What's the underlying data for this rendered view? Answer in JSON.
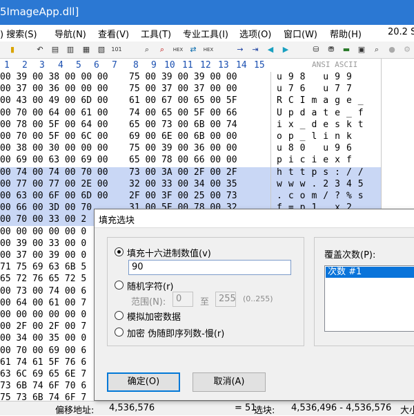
{
  "window": {
    "title": "5ImageApp.dll]"
  },
  "menu": [
    ") 搜索(S)",
    "导航(N)",
    "查看(V)",
    "工具(T)",
    "专业工具(I)",
    "选项(O)",
    "窗口(W)",
    "帮助(H)",
    "20.2 S"
  ],
  "toolbar_icons": [
    "new-icon",
    "open-icon",
    "undo-icon",
    "copy-icon",
    "paste-icon",
    "clipboard-icon",
    "copy-hex-icon",
    "binary-icon",
    "find-icon",
    "find-next-icon",
    "find-hex-icon",
    "replace-icon",
    "replace-hex-icon",
    "goto-icon",
    "goto-offset-icon",
    "back-icon",
    "forward-icon",
    "disk-icon",
    "save-disk-icon",
    "ram-icon",
    "table-icon",
    "zoom-icon",
    "gray-icon",
    "settings-icon"
  ],
  "columns": {
    "hex": [
      "1",
      "2",
      "3",
      "4",
      "5",
      "6",
      "7",
      "8",
      "9",
      "10",
      "11",
      "12",
      "13",
      "14",
      "15"
    ],
    "ascii_header": "ANSI ASCII"
  },
  "hex_rows": [
    {
      "left": "00 39 00 38 00 00 00",
      "right": "75 00 39 00 39 00 00"
    },
    {
      "left": "00 37 00 36 00 00 00",
      "right": "75 00 37 00 37 00 00"
    },
    {
      "left": "00 43 00 49 00 6D 00",
      "right": "61 00 67 00 65 00 5F"
    },
    {
      "left": "00 70 00 64 00 61 00",
      "right": "74 00 65 00 5F 00 66"
    },
    {
      "left": "00 78 00 5F 00 64 00",
      "right": "65 00 73 00 6B 00 74"
    },
    {
      "left": "00 70 00 5F 00 6C 00",
      "right": "69 00 6E 00 6B 00 00"
    },
    {
      "left": "00 38 00 30 00 00 00",
      "right": "75 00 39 00 36 00 00"
    },
    {
      "left": "00 69 00 63 00 69 00",
      "right": "65 00 78 00 66 00 00"
    },
    {
      "left": "00 74 00 74 00 70 00",
      "right": "73 00 3A 00 2F 00 2F",
      "sel": true
    },
    {
      "left": "00 77 00 77 00 2E 00",
      "right": "32 00 33 00 34 00 35",
      "sel": true
    },
    {
      "left": "00 63 00 6F 00 6D 00",
      "right": "2F 00 3F 00 25 00 73",
      "sel": true
    },
    {
      "left": "00 66 00 3D 00 70",
      "right": "31 00 5F 00 78 00 32",
      "sel": true
    },
    {
      "left": "00 70 00 33 00 2",
      "right": "",
      "sel": true
    },
    {
      "left": "00 00 00 00 00 0",
      "right": ""
    },
    {
      "left": "00 39 00 33 00 0",
      "right": ""
    },
    {
      "left": "00 37 00 39 00 0",
      "right": ""
    },
    {
      "left": "71 75 69 63 6B 5",
      "right": ""
    },
    {
      "left": "65 72 76 65 72 5",
      "right": ""
    },
    {
      "left": "00 73 00 74 00 6",
      "right": ""
    },
    {
      "left": "00 64 00 61 00 7",
      "right": ""
    },
    {
      "left": "00 00 00 00 00 0",
      "right": ""
    },
    {
      "left": "00 2F 00 2F 00 7",
      "right": ""
    },
    {
      "left": "00 34 00 35 00 0",
      "right": ""
    },
    {
      "left": "00 70 00 69 00 6",
      "right": ""
    },
    {
      "left": "61 74 61 5F 76 6",
      "right": ""
    },
    {
      "left": "63 6C 69 65 6E 7",
      "right": ""
    },
    {
      "left": "73 6B 74 6F 70 6",
      "right": ""
    },
    {
      "left": "75 73 6B 74 6F 7",
      "right": ""
    }
  ],
  "ascii_rows": [
    {
      "text": "u98 u99"
    },
    {
      "text": "u76 u77"
    },
    {
      "text": "RCImage_"
    },
    {
      "text": "Update_f"
    },
    {
      "text": "ix_deskt"
    },
    {
      "text": "op_link"
    },
    {
      "text": "u80 u96"
    },
    {
      "text": "piciexf"
    },
    {
      "text": "https://",
      "sel": true
    },
    {
      "text": "www.2345",
      "sel": true
    },
    {
      "text": ".com/?%s",
      "sel": true
    },
    {
      "text": "f=p1_x2",
      "sel": true
    }
  ],
  "status": {
    "offset_label": "偏移地址:",
    "offset_value": "4,536,576",
    "eq_value": "= 51",
    "block_label": "选块:",
    "block_value": "4,536,496 - 4,536,576",
    "size_label": "大小"
  },
  "dialog": {
    "title": "填充选块",
    "opt_hex": "填充十六进制数值(v)",
    "hex_value": "90",
    "opt_random": "随机字符(r)",
    "range_label": "范围(N):",
    "range_from": "0",
    "range_to_label": "至",
    "range_to": "255",
    "range_hint": "(0..255)",
    "opt_crypto": "模拟加密数据",
    "opt_prng": "加密 伪随即序列数-慢(r)",
    "overwrite_label": "覆盖次数(P):",
    "overwrite_item": "次数 #1",
    "ok": "确定(O)",
    "cancel": "取消(A)"
  }
}
